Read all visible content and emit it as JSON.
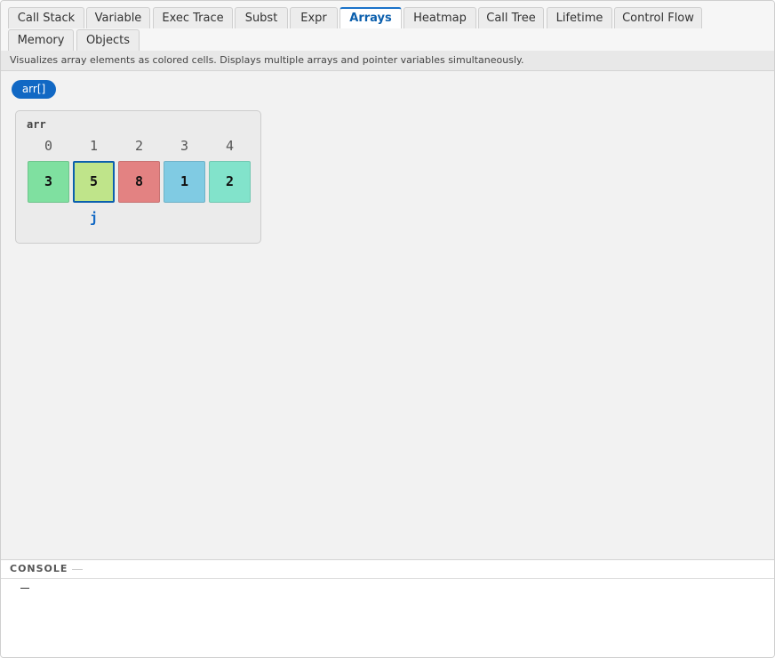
{
  "tabs": [
    {
      "label": "Call Stack",
      "active": false
    },
    {
      "label": "Variable",
      "active": false
    },
    {
      "label": "Exec Trace",
      "active": false
    },
    {
      "label": "Subst",
      "active": false
    },
    {
      "label": "Expr",
      "active": false
    },
    {
      "label": "Arrays",
      "active": true
    },
    {
      "label": "Heatmap",
      "active": false
    },
    {
      "label": "Call Tree",
      "active": false
    },
    {
      "label": "Lifetime",
      "active": false
    },
    {
      "label": "Control Flow",
      "active": false
    },
    {
      "label": "Memory",
      "active": false
    },
    {
      "label": "Objects",
      "active": false
    }
  ],
  "description": "Visualizes array elements as colored cells. Displays multiple arrays and pointer variables simultaneously.",
  "array_selector": "arr[]",
  "array": {
    "name": "arr",
    "indices": [
      "0",
      "1",
      "2",
      "3",
      "4"
    ],
    "values": [
      "3",
      "5",
      "8",
      "1",
      "2"
    ],
    "cell_colors": [
      "#7fe0a0",
      "#bfe48a",
      "#e38282",
      "#80cbe3",
      "#82e3cb"
    ],
    "highlight_index": 1,
    "pointers": [
      {
        "label": "j",
        "index": 1
      }
    ]
  },
  "console": {
    "title": "CONSOLE",
    "prompt": ""
  },
  "colors": {
    "accent": "#1168c4",
    "active_tab_text": "#0b5fad"
  }
}
